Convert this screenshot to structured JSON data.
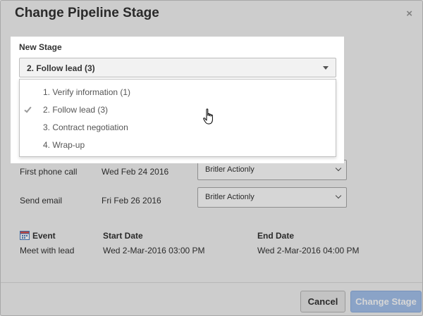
{
  "dialog": {
    "title": "Change Pipeline Stage",
    "close_glyph": "×",
    "close_icon": "close-icon"
  },
  "stage_field": {
    "label": "New Stage",
    "selected": "2. Follow lead (3)",
    "caret_icon": "caret-down-icon",
    "options": [
      {
        "label": "1. Verify information (1)",
        "checked": false
      },
      {
        "label": "2. Follow lead (3)",
        "checked": true
      },
      {
        "label": "3. Contract negotiation",
        "checked": false
      },
      {
        "label": "4. Wrap-up",
        "checked": false
      }
    ]
  },
  "tasks": [
    {
      "name": "First phone call",
      "date": "Wed Feb 24 2016",
      "owner": "Britler Actionly"
    },
    {
      "name": "Send email",
      "date": "Fri Feb 26 2016",
      "owner": "Britler Actionly"
    }
  ],
  "event": {
    "icon": "calendar-icon",
    "headers": {
      "event": "Event",
      "start": "Start Date",
      "end": "End Date"
    },
    "name": "Meet with lead",
    "start": "Wed 2-Mar-2016 03:00 PM",
    "end": "Wed 2-Mar-2016 04:00 PM"
  },
  "footer": {
    "cancel_label": "Cancel",
    "confirm_label": "Change Stage"
  },
  "colors": {
    "primary_button": "#a5c3ee",
    "overlay": "rgba(0,0,0,0.16)"
  }
}
